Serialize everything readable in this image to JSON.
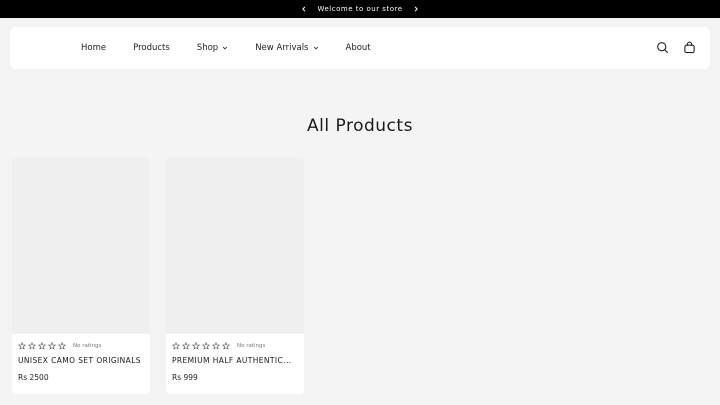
{
  "announcement": {
    "text": "Welcome to our store",
    "prev_icon": "chevron-left-icon",
    "next_icon": "chevron-right-icon"
  },
  "nav": {
    "items": [
      {
        "label": "Home",
        "has_dropdown": false
      },
      {
        "label": "Products",
        "has_dropdown": false
      },
      {
        "label": "Shop",
        "has_dropdown": true
      },
      {
        "label": "New Arrivals",
        "has_dropdown": true
      },
      {
        "label": "About",
        "has_dropdown": false
      }
    ],
    "icons": [
      "search-icon",
      "cart-icon"
    ]
  },
  "page": {
    "title": "All Products"
  },
  "products": [
    {
      "title": "UNISEX CAMO SET ORIGINALS",
      "price": "Rs 2500",
      "rating_text": "No ratings",
      "stars_filled": 0,
      "stars_total": 5
    },
    {
      "title": "PREMIUM HALF AUTHENTIC...",
      "price": "Rs 999",
      "rating_text": "No ratings",
      "stars_filled": 0,
      "stars_total": 5
    }
  ],
  "colors": {
    "announcement_bg": "#000000",
    "page_bg": "#f4f4f4",
    "card_bg": "#ffffff"
  }
}
